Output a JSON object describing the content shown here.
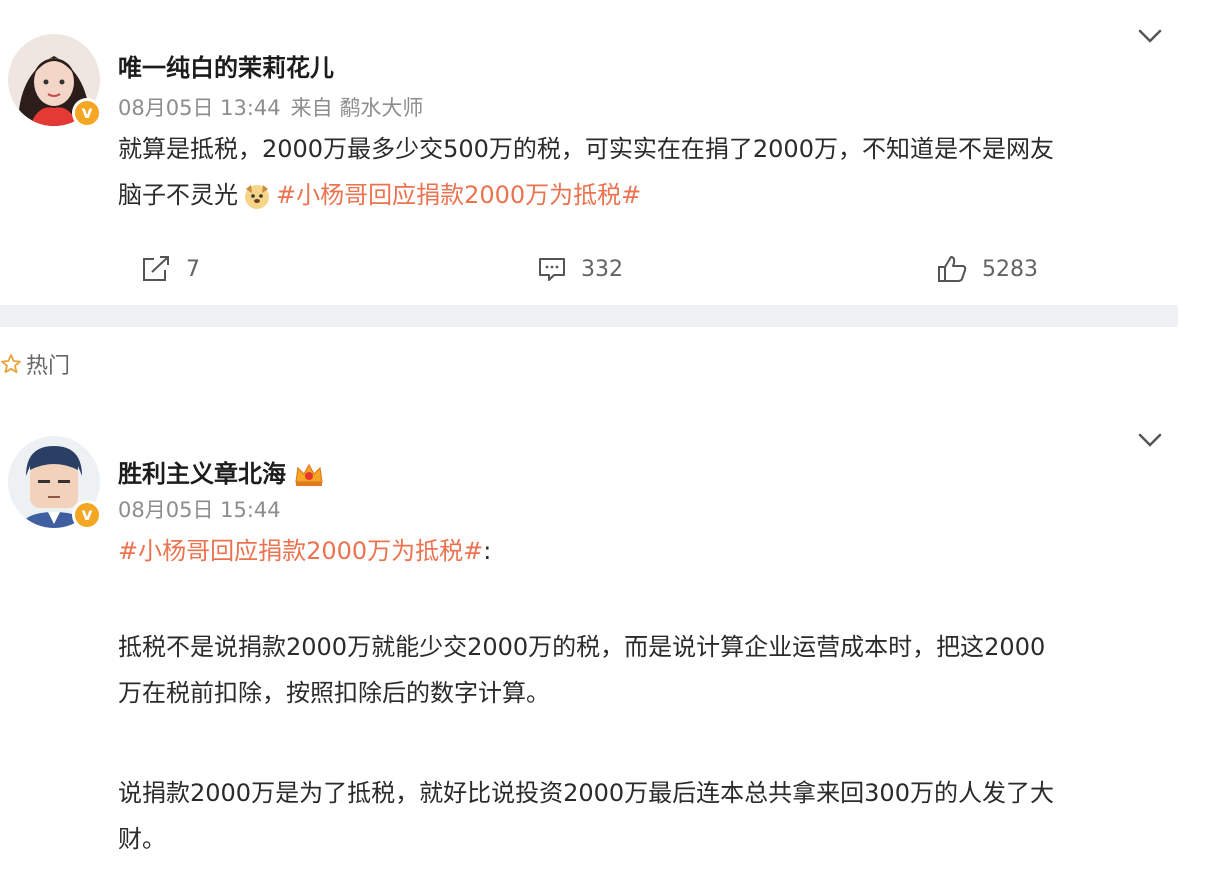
{
  "posts": [
    {
      "username": "唯一纯白的茉莉花儿",
      "date": "08月05日 13:44",
      "source": "来自 鹬水大师",
      "lines": [
        "就算是抵税，2000万最多少交500万的税，可实实在在捐了2000万，不知道是不是网友",
        "脑子不灵光"
      ],
      "hashtag": "#小杨哥回应捐款2000万为抵税#",
      "actions": {
        "repost": "7",
        "comment": "332",
        "like": "5283"
      }
    },
    {
      "username": "胜利主义章北海",
      "date": "08月05日 15:44",
      "hashtag": "#小杨哥回应捐款2000万为抵税#",
      "hashtag_suffix": ":",
      "paragraphs": [
        [
          "抵税不是说捐款2000万就能少交2000万的税，而是说计算企业运营成本时，把这2000",
          "万在税前扣除，按照扣除后的数字计算。"
        ],
        [
          "说捐款2000万是为了抵税，就好比说投资2000万最后连本总共拿来回300万的人发了大",
          "财。"
        ]
      ]
    }
  ],
  "section": {
    "hot_label": "热门"
  },
  "colors": {
    "accent": "#eb7350",
    "badge": "#f5a623",
    "text": "#2b2b2b",
    "meta": "#8d8d8d"
  },
  "icons": [
    "repost-icon",
    "comment-icon",
    "like-icon",
    "chevron-down-icon",
    "star-icon",
    "verified-badge-icon",
    "crown-icon",
    "dog-emoji-icon"
  ]
}
